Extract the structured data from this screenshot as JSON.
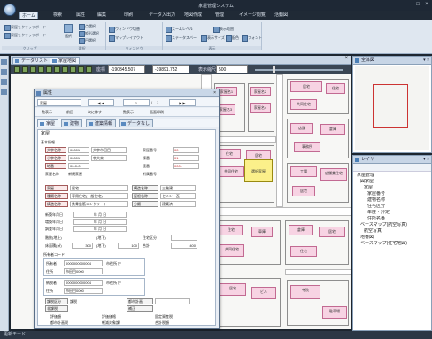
{
  "window": {
    "title": "家屋管理システム"
  },
  "menu": [
    "ホーム",
    "検索",
    "属性",
    "編集",
    "印刷",
    "データ入出力",
    "地図作成",
    "管理",
    "イメージ閲覧",
    "活動図"
  ],
  "ribbon": {
    "g1": [
      "家屋をクリップボード",
      "家屋をクリップボード"
    ],
    "g2": [
      "選択",
      "点選択",
      "矩形選択",
      "円選択"
    ],
    "g3": [
      "ウィンドウ切替",
      "マップレイアウト"
    ],
    "g4": [
      "ズームレベル",
      "表示範囲",
      "ステータスバー",
      "表示サイズ",
      "配色",
      "フォント"
    ],
    "labels": [
      "クリップ",
      "選択",
      "ウィンドウ",
      "表示"
    ]
  },
  "map": {
    "tabs": [
      "データリスト",
      "家屋地図"
    ],
    "coord_label": "座標",
    "x": "-190345.507",
    "y": "-39891.752",
    "scale_label": "表示縮尺",
    "scale": "500",
    "buildings": [
      "家屋名1",
      "家屋名2",
      "家屋名3",
      "家屋名4",
      "居宅",
      "住宅",
      "共同住宅",
      "店舗",
      "倉庫",
      "事務所",
      "住宅",
      "居宅",
      "共同住宅",
      "工場",
      "店舗兼住宅",
      "居宅",
      "住宅",
      "車庫",
      "倉庫",
      "居宅",
      "共同住宅",
      "住宅",
      "居宅",
      "ビル",
      "寺院",
      "駐車場"
    ],
    "selected_label": "選択家屋"
  },
  "dialog": {
    "title": "属性",
    "layer": "家屋",
    "record": "1",
    "total": "1",
    "toolbar": [
      "一覧表示",
      "前回",
      "次に移す",
      "一覧表示",
      "画面印刷"
    ],
    "tabs": [
      "家屋",
      "建物",
      "建築情報",
      "データなし"
    ],
    "section": "家屋",
    "basic_title": "基本情報",
    "rows": [
      {
        "l": "大字名称",
        "c": "00001",
        "v": "大字市田目",
        "l2": "家屋番号",
        "v2": "00"
      },
      {
        "l": "小字名称",
        "c": "00001",
        "v": "字大来",
        "l2": "棟番",
        "v2": "01"
      },
      {
        "l": "地番",
        "c": "00-0-0",
        "v": "",
        "l2": "連番",
        "v2": "0001"
      },
      {
        "l": "家屋名称",
        "c": "新規家屋",
        "v": "",
        "l2": "附属番号",
        "v2": ""
      }
    ],
    "info": [
      {
        "l": "家屋",
        "v": "居宅",
        "l2": "構造名称",
        "v2": "三階建"
      },
      {
        "l": "種類名称",
        "v": "専用住宅(一般住宅)",
        "l2": "屋根名称",
        "v2": "セメント瓦"
      },
      {
        "l": "構造名称",
        "v": "鉄骨鉄筋コンクリート",
        "l2": "分類",
        "v2": "建築済"
      }
    ],
    "dates": [
      {
        "l": "新築年月日",
        "v": "年 月 日"
      },
      {
        "l": "増築年月日",
        "v": "年 月 日"
      },
      {
        "l": "調査年月日",
        "v": "年 月 日"
      }
    ],
    "floors": {
      "l": "階数(地上)",
      "v": "(地下)",
      "l2": "住宅区分"
    },
    "area": {
      "l": "床面積(㎡)",
      "v1": "300",
      "u1": "(地下)",
      "v2": "100",
      "l3": "合計",
      "v3": "400"
    },
    "owner_title": "所有者コード",
    "owner1": {
      "l": "所有者",
      "c": "0000000000004",
      "n": "市役所 庁",
      "addr_l": "住所",
      "addr": "市田目0000"
    },
    "owner2": {
      "l": "納税者",
      "c": "0000000000004",
      "n": "市役所 庁",
      "addr_l": "住所",
      "addr": "市田目0000"
    },
    "tax": [
      {
        "l": "課税区分",
        "v": "課税",
        "l2": "都市計画",
        "v2": ""
      },
      {
        "l": "非課税",
        "v": "",
        "l2": "補正",
        "v2": ""
      }
    ],
    "eval": [
      "評価額",
      "評価価格",
      "固定資産税"
    ],
    "eval2": [
      "都市計画税",
      "軽減対象課",
      "合計税額"
    ]
  },
  "panels": {
    "overview": "全体図",
    "layers": "レイヤ",
    "tree": [
      "家屋管理",
      "図家屋",
      "家屋",
      "家屋番号",
      "建物名称",
      "住宅区分",
      "年度・評定",
      "住所名番",
      "ベースマップ(航空写真)",
      "航空写真",
      "地番図",
      "ベースマップ(住宅地図)"
    ]
  },
  "status": "更新モード"
}
